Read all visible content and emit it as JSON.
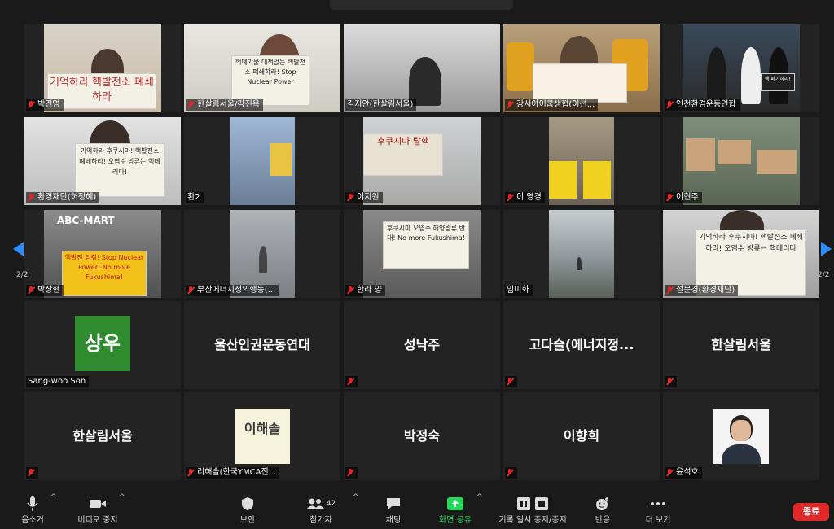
{
  "pagination": {
    "left_label": "2/2",
    "right_label": "2/2"
  },
  "tiles": [
    {
      "name": "박건영",
      "muted": true,
      "sign": "기억하라 핵발전소 폐쇄하라"
    },
    {
      "name": "한살림서울/강진옥",
      "muted": true,
      "sign": "핵폐기물 대책없는 핵발전소 폐쇄하라! Stop Nuclear Power"
    },
    {
      "name": "김지안(한살림서울)",
      "muted": false,
      "sign": ""
    },
    {
      "name": "강서아이쿱생협(이선...",
      "muted": true,
      "sign": ""
    },
    {
      "name": "인천환경운동연합",
      "muted": true,
      "sign": "핵 폐기하라!"
    },
    {
      "name": "환경재단(허정혜)",
      "muted": true,
      "sign": "기억하라 후쿠시마! 핵발전소 폐쇄하라! 오염수 방류는 핵테러다!"
    },
    {
      "name": "환2",
      "muted": false,
      "sign": ""
    },
    {
      "name": "이지원",
      "muted": true,
      "sign": "후쿠시마 탈핵"
    },
    {
      "name": "이 영경",
      "muted": true,
      "sign": ""
    },
    {
      "name": "이현주",
      "muted": true,
      "sign": ""
    },
    {
      "name": "박상현",
      "muted": true,
      "sign": "핵발전 멈춰! Stop Nuclear Power! No more Fukushima!",
      "store": "ABC-MART"
    },
    {
      "name": "부산에너지정의행동(...",
      "muted": true,
      "sign": ""
    },
    {
      "name": "한라 양",
      "muted": true,
      "sign": "후쿠시마 오염수 해양방류 반대! No more Fukushima!"
    },
    {
      "name": "임미화",
      "muted": false,
      "sign": ""
    },
    {
      "name": "설문경(환경재단)",
      "muted": true,
      "sign": "기억하라 후쿠시마! 핵발전소 폐쇄하라! 오염수 방류는 핵테러다"
    },
    {
      "name": "Sang-woo Son",
      "muted": false,
      "avatar": "상우"
    },
    {
      "name": "",
      "muted": false,
      "big": "울산인권운동연대"
    },
    {
      "name": "",
      "muted": true,
      "big": "성낙주"
    },
    {
      "name": "",
      "muted": true,
      "big": "고다슬(에너지정..."
    },
    {
      "name": "",
      "muted": true,
      "big": "한살림서울"
    },
    {
      "name": "",
      "muted": true,
      "big": "한살림서울"
    },
    {
      "name": "리해솔(한국YMCA전...",
      "muted": true,
      "logo": "이해솔"
    },
    {
      "name": "",
      "muted": true,
      "big": "박정숙"
    },
    {
      "name": "",
      "muted": true,
      "big": "이향희"
    },
    {
      "name": "윤석호",
      "muted": true,
      "photo": true
    }
  ],
  "toolbar": {
    "mute": "음소거",
    "video": "비디오 중지",
    "security": "보안",
    "participants": "참가자",
    "participants_count": "42",
    "chat": "채팅",
    "share": "화면 공유",
    "record": "기록 일시 중지/중지",
    "reactions": "반응",
    "more": "더 보기",
    "end": "종료"
  },
  "colors": {
    "accent_green": "#23d959",
    "end_red": "#e02828",
    "avatar_green": "#2e8b2e"
  }
}
